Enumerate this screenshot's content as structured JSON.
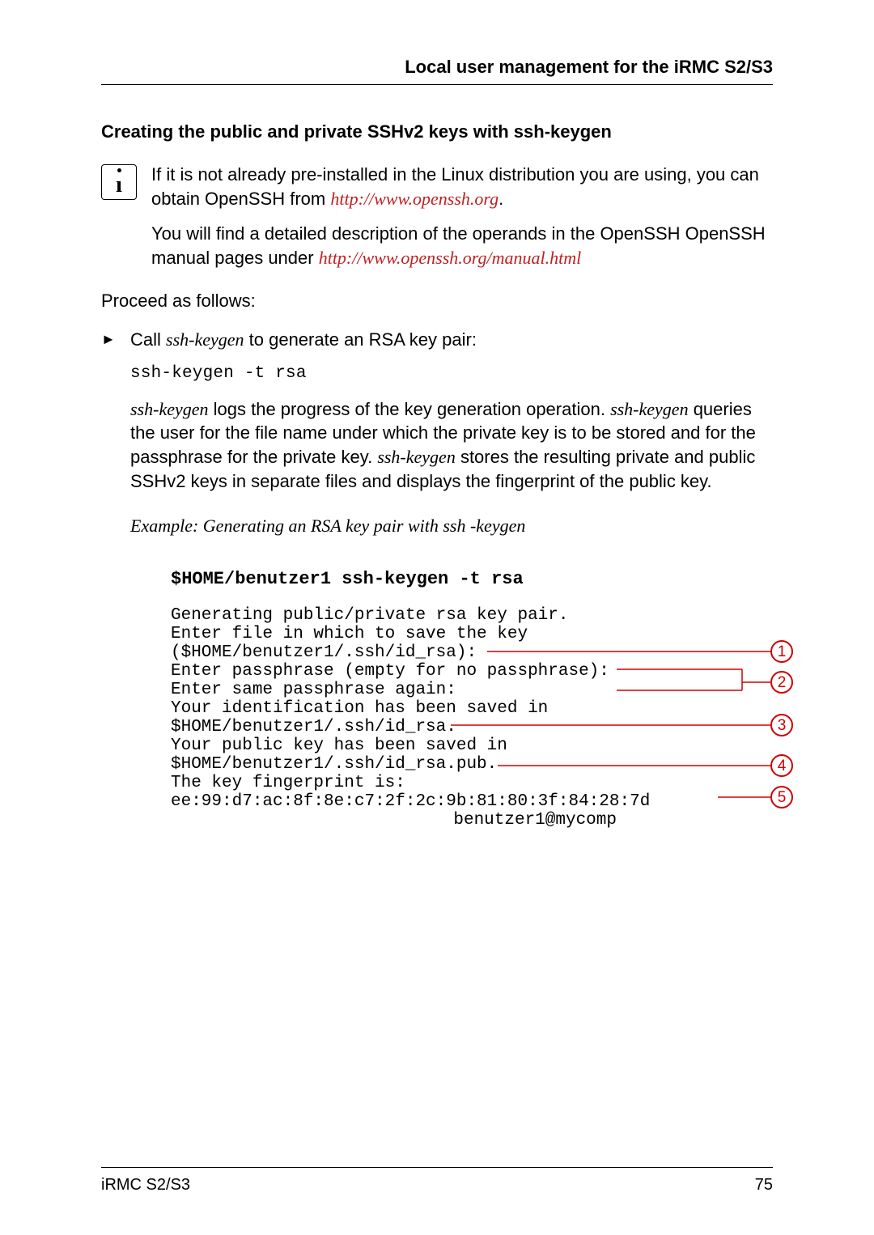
{
  "header_title": "Local user management for the iRMC S2/S3",
  "subheading": "Creating the public and private SSHv2 keys with ssh-keygen",
  "info_para1_pre": "If it is not already pre-installed in the Linux distribution you are using, you can obtain OpenSSH from ",
  "info_link1": "http://www.openssh.org",
  "info_para1_post": ".",
  "info_para2_pre": "You will find a detailed description of the operands in the OpenSSH OpenSSH manual pages under ",
  "info_link2": "http://www.openssh.org/manual.html",
  "proceed": "Proceed as follows:",
  "step1_pre": "Call ",
  "step1_cmd": "ssh-keygen",
  "step1_post": " to generate an RSA key pair:",
  "code1": "ssh-keygen -t rsa",
  "step1_para_a": "ssh-keygen",
  "step1_para_b": " logs the progress of the key generation operation. ",
  "step1_para_c": "ssh-keygen",
  "step1_para_d": " queries the user for the file name under which the private key is to be stored and for the passphrase for the private key. ",
  "step1_para_e": "ssh-keygen",
  "step1_para_f": " stores the resulting private and public SSHv2 keys in separate files and displays the fingerprint of the public key.",
  "example_title": "Example: Generating an RSA key pair with ssh -keygen",
  "terminal_cmd": "$HOME/benutzer1 ssh-keygen -t rsa",
  "tl1": "Generating public/private rsa key pair.",
  "tl2": "Enter file in which to save the key",
  "tl3": "($HOME/benutzer1/.ssh/id_rsa):",
  "tl4": "Enter passphrase (empty for no passphrase):",
  "tl5": "Enter same passphrase again:",
  "tl6": "Your identification has been saved in",
  "tl7": "$HOME/benutzer1/.ssh/id_rsa.",
  "tl8": "Your public key has been saved in",
  "tl9": "$HOME/benutzer1/.ssh/id_rsa.pub.",
  "tl10": "The key fingerprint is:",
  "tl11": "ee:99:d7:ac:8f:8e:c7:2f:2c:9b:81:80:3f:84:28:7d",
  "tl12": "benutzer1@mycomp",
  "c1": "1",
  "c2": "2",
  "c3": "3",
  "c4": "4",
  "c5": "5",
  "footer_left": "iRMC S2/S3",
  "footer_right": "75"
}
